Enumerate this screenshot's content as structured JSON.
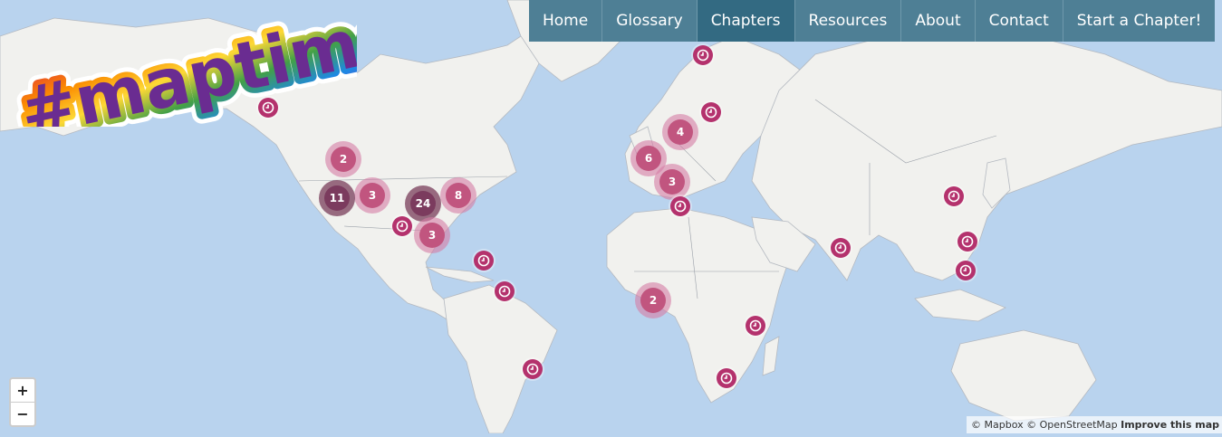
{
  "logo_text": "#maptime!",
  "nav": {
    "items": [
      {
        "label": "Home"
      },
      {
        "label": "Glossary"
      },
      {
        "label": "Chapters",
        "active": true
      },
      {
        "label": "Resources"
      },
      {
        "label": "About"
      },
      {
        "label": "Contact"
      },
      {
        "label": "Start a Chapter!"
      }
    ]
  },
  "clusters": [
    {
      "count": "2",
      "style": "normal"
    },
    {
      "count": "3",
      "style": "normal"
    },
    {
      "count": "11",
      "style": "dark"
    },
    {
      "count": "24",
      "style": "dark"
    },
    {
      "count": "8",
      "style": "normal"
    },
    {
      "count": "3",
      "style": "normal"
    },
    {
      "count": "4",
      "style": "normal"
    },
    {
      "count": "6",
      "style": "normal"
    },
    {
      "count": "3",
      "style": "normal"
    },
    {
      "count": "2",
      "style": "normal"
    }
  ],
  "pin_count": 16,
  "zoom": {
    "in_label": "+",
    "out_label": "−"
  },
  "attribution": {
    "mapbox": "© Mapbox",
    "osm": "© OpenStreetMap",
    "improve": "Improve this map"
  },
  "colors": {
    "ocean": "#b9d3ee",
    "land": "#f1f1ee",
    "marker": "#b4326d",
    "nav": "#4e7f95",
    "nav_active": "#336a82"
  }
}
